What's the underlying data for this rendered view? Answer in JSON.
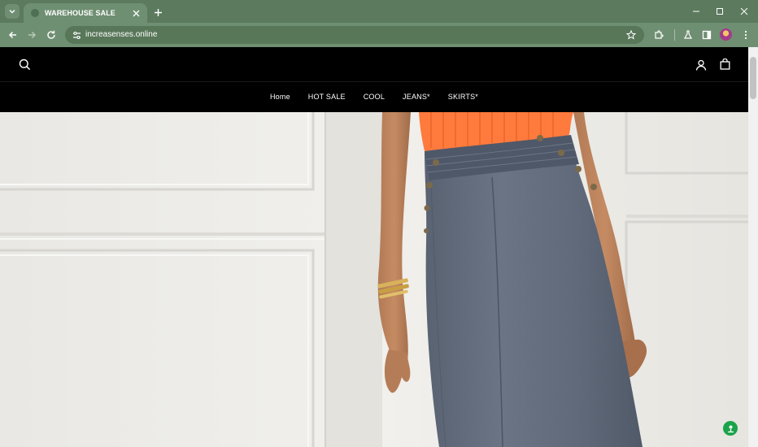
{
  "browser": {
    "tab": {
      "title": "WAREHOUSE SALE"
    },
    "address_bar": {
      "url": "increasenses.online"
    }
  },
  "site": {
    "logo_text": "",
    "nav": [
      {
        "label": "Home"
      },
      {
        "label": "HOT SALE"
      },
      {
        "label": "COOL"
      },
      {
        "label": "JEANS*"
      },
      {
        "label": "SKIRTS*"
      }
    ]
  },
  "colors": {
    "browser_frame": "#5b7a5e",
    "toolbar": "#6f8f72",
    "site_header": "#000000",
    "chat_button": "#1aa34a",
    "top_orange": "#ff7a3d",
    "skirt_denim": "#5f6878"
  },
  "icons": {
    "tab_menu": "chevron-down-icon",
    "tab_close": "close-icon",
    "new_tab": "plus-icon",
    "back": "arrow-left-icon",
    "forward": "arrow-right-icon",
    "reload": "reload-icon",
    "site_info": "tune-icon",
    "bookmark": "star-icon",
    "extensions": "puzzle-icon",
    "labs": "flask-icon",
    "side_panel": "side-panel-icon",
    "menu": "more-vert-icon",
    "search": "search-icon",
    "account": "user-icon",
    "cart": "shopping-bag-icon",
    "chat": "chat-icon"
  }
}
